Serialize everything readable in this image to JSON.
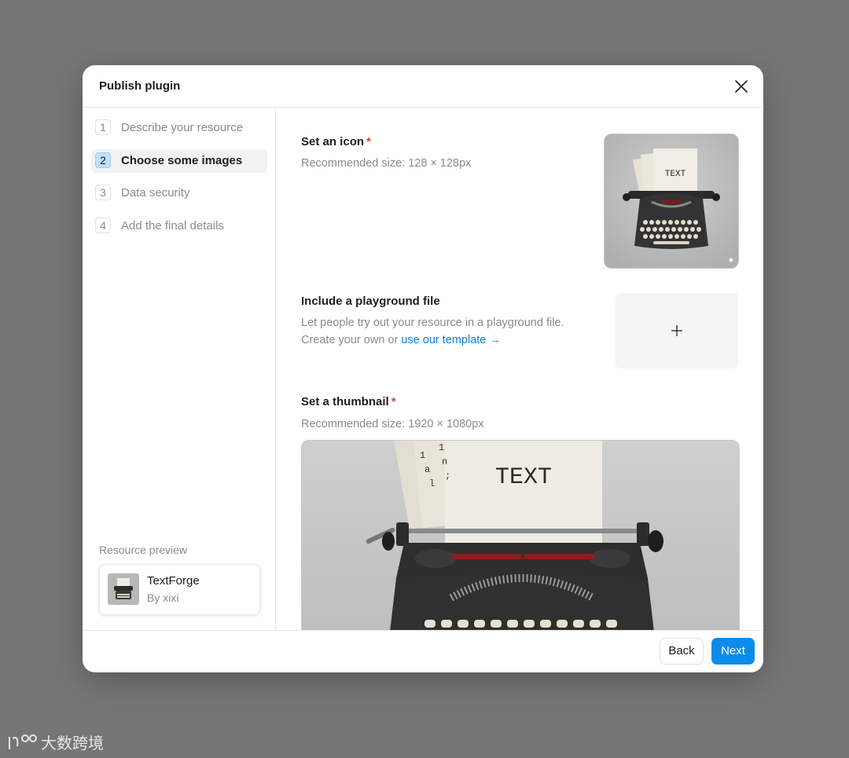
{
  "modal": {
    "title": "Publish plugin"
  },
  "steps": [
    {
      "num": "1",
      "label": "Describe your resource",
      "active": false
    },
    {
      "num": "2",
      "label": "Choose some images",
      "active": true
    },
    {
      "num": "3",
      "label": "Data security",
      "active": false
    },
    {
      "num": "4",
      "label": "Add the final details",
      "active": false
    }
  ],
  "preview": {
    "label": "Resource preview",
    "name": "TextForge",
    "author": "By xixi"
  },
  "sections": {
    "icon": {
      "title": "Set an icon",
      "required": "*",
      "desc": "Recommended size: 128 × 128px",
      "image_text": "TEXT"
    },
    "playground": {
      "title": "Include a playground file",
      "desc_line1": "Let people try out your resource in a playground file.",
      "desc_line2_prefix": "Create your own or",
      "link": "use our template →"
    },
    "thumbnail": {
      "title": "Set a thumbnail",
      "required": "*",
      "desc": "Recommended size: 1920 × 1080px",
      "image_text": "TEXT"
    }
  },
  "footer": {
    "back_label": "Back",
    "next_label": "Next"
  },
  "colors": {
    "accent": "#0c8ce9",
    "link": "#0d7fd6",
    "required": "#e03e2d",
    "active_step_badge": "#bfe0fb",
    "backdrop": "#767676"
  },
  "watermark": {
    "text": "大数跨境"
  }
}
